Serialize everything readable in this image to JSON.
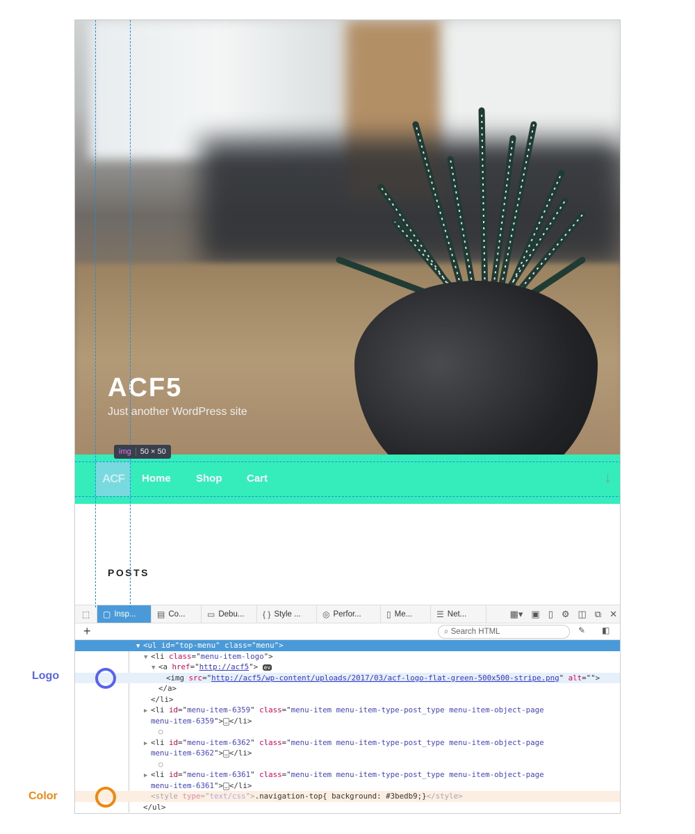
{
  "site": {
    "title": "ACF5",
    "description": "Just another WordPress site",
    "posts_heading": "POSTS"
  },
  "nav": {
    "logo_text": "ACF",
    "items": [
      {
        "label": "Home"
      },
      {
        "label": "Shop"
      },
      {
        "label": "Cart"
      }
    ],
    "background": "#35edbb",
    "scroll_icon": "arrow-down-icon"
  },
  "tooltip": {
    "tag": "img",
    "size": "50 × 50"
  },
  "devtools": {
    "tabs": [
      {
        "label": "Insp...",
        "icon": "inspector-icon",
        "active": true
      },
      {
        "label": "Co...",
        "icon": "console-icon"
      },
      {
        "label": "Debu...",
        "icon": "debugger-icon"
      },
      {
        "label": "Style ...",
        "icon": "braces-icon"
      },
      {
        "label": "Perfor...",
        "icon": "performance-icon"
      },
      {
        "label": "Me...",
        "icon": "memory-icon"
      },
      {
        "label": "Net...",
        "icon": "network-icon"
      }
    ],
    "search_placeholder": "Search HTML",
    "lines": [
      {
        "indent": 0,
        "tw": "▼",
        "state": "sel",
        "seg": [
          [
            "tag",
            "<"
          ],
          [
            "name",
            "ul"
          ],
          [
            "text",
            " "
          ],
          [
            "attr",
            "id"
          ],
          [
            "text",
            "=\""
          ],
          [
            "val",
            "top-menu"
          ],
          [
            "text",
            "\" "
          ],
          [
            "attr",
            "class"
          ],
          [
            "text",
            "=\""
          ],
          [
            "val",
            "menu"
          ],
          [
            "text",
            "\">"
          ]
        ]
      },
      {
        "indent": 1,
        "tw": "▼",
        "seg": [
          [
            "tag",
            "<"
          ],
          [
            "name",
            "li"
          ],
          [
            "text",
            " "
          ],
          [
            "attr",
            "class"
          ],
          [
            "text",
            "=\""
          ],
          [
            "val",
            "menu-item-logo"
          ],
          [
            "text",
            "\">"
          ]
        ]
      },
      {
        "indent": 2,
        "tw": "▼",
        "seg": [
          [
            "tag",
            "<"
          ],
          [
            "name",
            "a"
          ],
          [
            "text",
            " "
          ],
          [
            "attr",
            "href"
          ],
          [
            "text",
            "=\""
          ],
          [
            "link",
            "http://acf5"
          ],
          [
            "text",
            "\"> "
          ],
          [
            "ev",
            "ev"
          ]
        ]
      },
      {
        "indent": 3,
        "tw": "",
        "state": "hl",
        "seg": [
          [
            "tag",
            "<"
          ],
          [
            "name",
            "img"
          ],
          [
            "text",
            " "
          ],
          [
            "attr",
            "src"
          ],
          [
            "text",
            "=\""
          ],
          [
            "link",
            "http://acf5/wp-content/uploads/2017/03/acf-logo-flat-green-500x500-stripe.png"
          ],
          [
            "text",
            "\" "
          ],
          [
            "attr",
            "alt"
          ],
          [
            "text",
            "=\"\">"
          ]
        ]
      },
      {
        "indent": 2,
        "tw": "",
        "seg": [
          [
            "text",
            "</a>"
          ]
        ]
      },
      {
        "indent": 1,
        "tw": "",
        "seg": [
          [
            "text",
            "</li>"
          ]
        ]
      },
      {
        "indent": 1,
        "tw": "▶",
        "seg": [
          [
            "tag",
            "<"
          ],
          [
            "name",
            "li"
          ],
          [
            "text",
            " "
          ],
          [
            "attr",
            "id"
          ],
          [
            "text",
            "=\""
          ],
          [
            "val",
            "menu-item-6359"
          ],
          [
            "text",
            "\" "
          ],
          [
            "attr",
            "class"
          ],
          [
            "text",
            "=\""
          ],
          [
            "val",
            "menu-item menu-item-type-post_type menu-item-object-page"
          ]
        ]
      },
      {
        "indent": 1,
        "tw": "",
        "seg": [
          [
            "val",
            "menu-item-6359"
          ],
          [
            "text",
            "\">"
          ],
          [
            "ell",
            "…"
          ],
          [
            "text",
            "</li>"
          ]
        ]
      },
      {
        "indent": 2,
        "tw": "",
        "seg": [
          [
            "bullet",
            "○"
          ]
        ]
      },
      {
        "indent": 1,
        "tw": "▶",
        "seg": [
          [
            "tag",
            "<"
          ],
          [
            "name",
            "li"
          ],
          [
            "text",
            " "
          ],
          [
            "attr",
            "id"
          ],
          [
            "text",
            "=\""
          ],
          [
            "val",
            "menu-item-6362"
          ],
          [
            "text",
            "\" "
          ],
          [
            "attr",
            "class"
          ],
          [
            "text",
            "=\""
          ],
          [
            "val",
            "menu-item menu-item-type-post_type menu-item-object-page"
          ]
        ]
      },
      {
        "indent": 1,
        "tw": "",
        "seg": [
          [
            "val",
            "menu-item-6362"
          ],
          [
            "text",
            "\">"
          ],
          [
            "ell",
            "…"
          ],
          [
            "text",
            "</li>"
          ]
        ]
      },
      {
        "indent": 2,
        "tw": "",
        "seg": [
          [
            "bullet",
            "○"
          ]
        ]
      },
      {
        "indent": 1,
        "tw": "▶",
        "seg": [
          [
            "tag",
            "<"
          ],
          [
            "name",
            "li"
          ],
          [
            "text",
            " "
          ],
          [
            "attr",
            "id"
          ],
          [
            "text",
            "=\""
          ],
          [
            "val",
            "menu-item-6361"
          ],
          [
            "text",
            "\" "
          ],
          [
            "attr",
            "class"
          ],
          [
            "text",
            "=\""
          ],
          [
            "val",
            "menu-item menu-item-type-post_type menu-item-object-page"
          ]
        ]
      },
      {
        "indent": 1,
        "tw": "",
        "seg": [
          [
            "val",
            "menu-item-6361"
          ],
          [
            "text",
            "\">"
          ],
          [
            "ell",
            "…"
          ],
          [
            "text",
            "</li>"
          ]
        ]
      },
      {
        "indent": 1,
        "tw": "",
        "state": "hl2",
        "seg": [
          [
            "dim",
            "<style "
          ],
          [
            "dimattr",
            "type"
          ],
          [
            "dim",
            "=\""
          ],
          [
            "dimval",
            "text/css"
          ],
          [
            "dim",
            "\">"
          ],
          [
            "text",
            ".navigation-top{ background: #3bedb9;}"
          ],
          [
            "dim",
            "</style>"
          ]
        ]
      },
      {
        "indent": 0,
        "tw": "",
        "seg": [
          [
            "text",
            "</ul>"
          ]
        ]
      }
    ]
  },
  "annotations": [
    {
      "label": "Logo",
      "color": "#5563f0"
    },
    {
      "label": "Color",
      "color": "#f0870f"
    }
  ]
}
